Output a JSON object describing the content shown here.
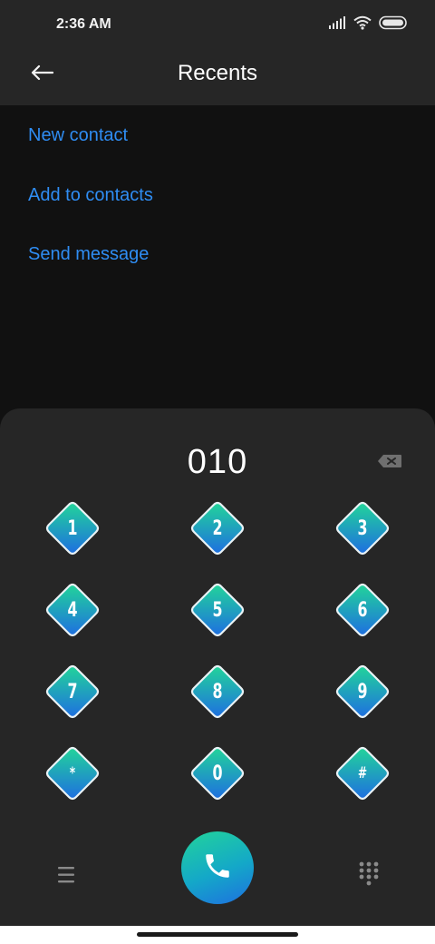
{
  "status_bar": {
    "time": "2:36 AM",
    "icons": [
      "signal-icon",
      "wifi-icon",
      "battery-icon"
    ]
  },
  "app_bar": {
    "title": "Recents",
    "back_icon": "back-arrow-icon"
  },
  "actions": [
    {
      "label": "New contact"
    },
    {
      "label": "Add to contacts"
    },
    {
      "label": "Send message"
    }
  ],
  "dialer": {
    "number": "010",
    "backspace_icon": "backspace-icon",
    "keys": [
      "1",
      "2",
      "3",
      "4",
      "5",
      "6",
      "7",
      "8",
      "9",
      "*",
      "0",
      "#"
    ]
  },
  "bottom_bar": {
    "menu_icon": "menu-icon",
    "call_icon": "phone-icon",
    "keypad_icon": "keypad-icon"
  },
  "colors": {
    "accent_link": "#2f8df3",
    "key_gradient_top": "#22d49a",
    "key_gradient_bottom": "#1e6fe0",
    "panel": "#262626",
    "background": "#111111"
  }
}
